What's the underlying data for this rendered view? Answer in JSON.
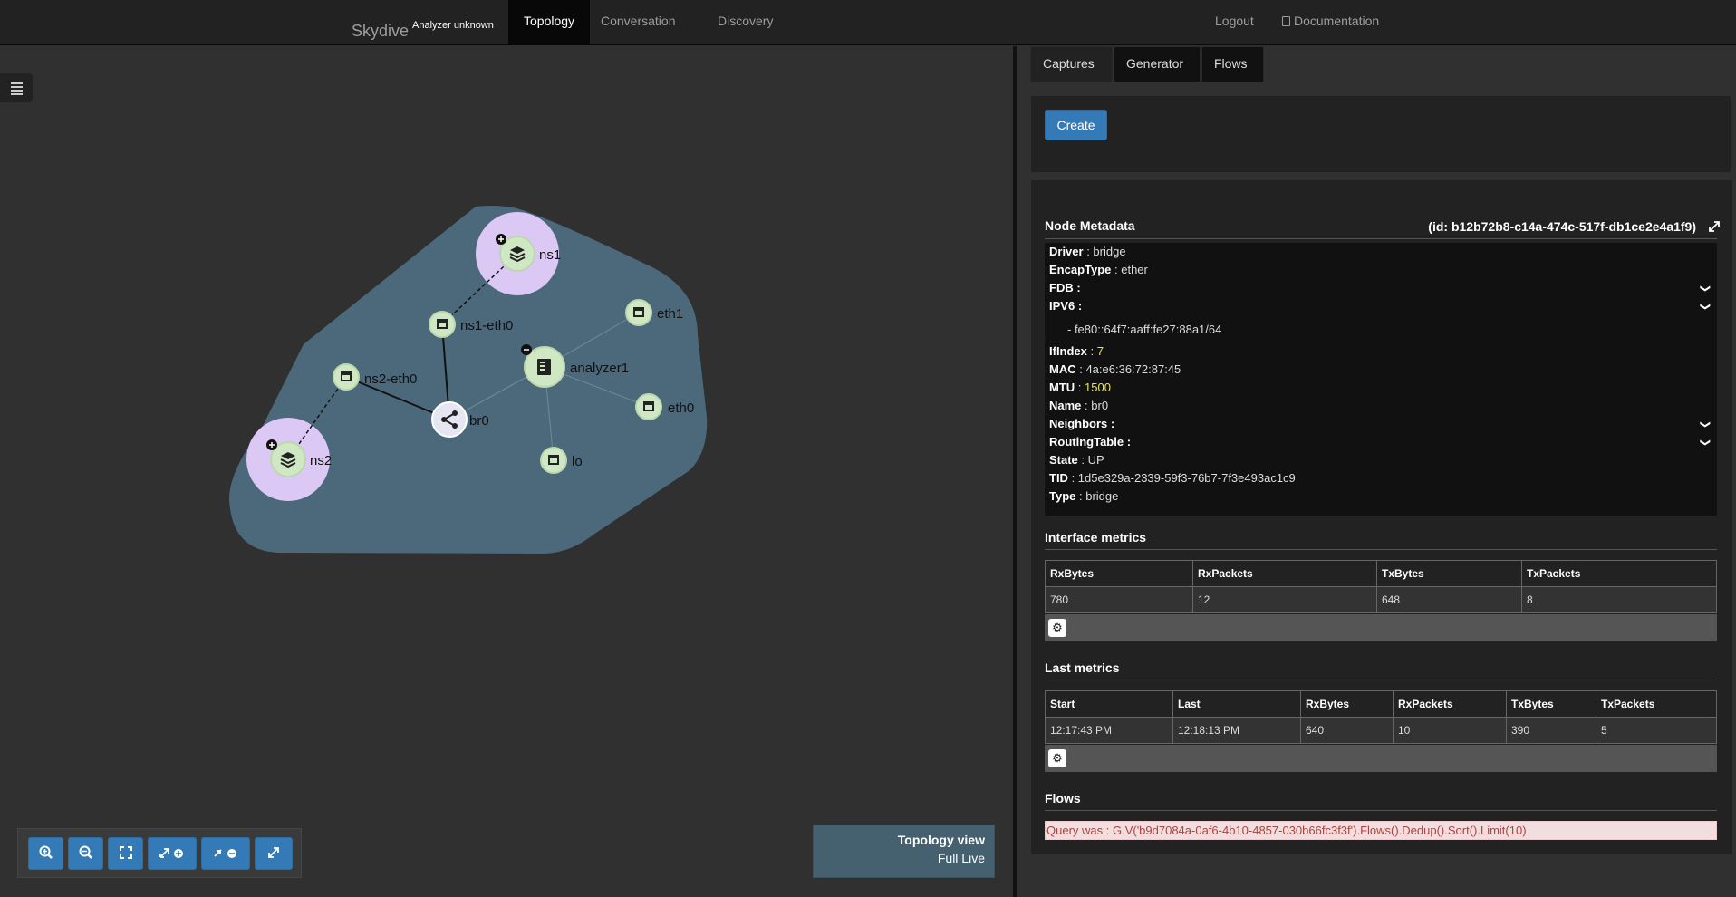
{
  "navbar": {
    "brand": "Skydive",
    "brand_sub": "Analyzer unknown",
    "tabs": [
      "Topology",
      "Conversation",
      "Discovery"
    ],
    "logout": "Logout",
    "documentation": "Documentation"
  },
  "graph": {
    "nodes": [
      {
        "id": "ns1",
        "label": "ns1",
        "icon": "namespace-stack-icon"
      },
      {
        "id": "ns1-eth0",
        "label": "ns1-eth0",
        "icon": "interface-icon"
      },
      {
        "id": "eth1",
        "label": "eth1",
        "icon": "interface-icon"
      },
      {
        "id": "analyzer1",
        "label": "analyzer1",
        "icon": "host-server-icon"
      },
      {
        "id": "ns2-eth0",
        "label": "ns2-eth0",
        "icon": "interface-icon"
      },
      {
        "id": "br0",
        "label": "br0",
        "icon": "bridge-icon"
      },
      {
        "id": "eth0",
        "label": "eth0",
        "icon": "interface-icon"
      },
      {
        "id": "ns2",
        "label": "ns2",
        "icon": "namespace-stack-icon"
      },
      {
        "id": "lo",
        "label": "lo",
        "icon": "interface-icon"
      }
    ]
  },
  "toolbar": {
    "buttons": [
      "zoom-in-icon",
      "zoom-out-icon",
      "fullscreen-icon",
      "expand-all-icon",
      "collapse-all-icon",
      "compress-icon"
    ]
  },
  "view_box": {
    "title": "Topology view",
    "mode": "Full Live"
  },
  "right_tabs": [
    "Captures",
    "Generator",
    "Flows"
  ],
  "create_label": "Create",
  "node_metadata": {
    "title": "Node Metadata",
    "id": "(id: b12b72b8-c14a-474c-517f-db1ce2e4a1f9)",
    "rows": [
      {
        "key": "Driver",
        "value": "bridge"
      },
      {
        "key": "EncapType",
        "value": "ether"
      },
      {
        "key": "FDB",
        "value": ""
      },
      {
        "key": "IPV6",
        "value": ""
      },
      {
        "key": "IfIndex",
        "value": "7"
      },
      {
        "key": "MAC",
        "value": "4a:e6:36:72:87:45"
      },
      {
        "key": "MTU",
        "value": "1500"
      },
      {
        "key": "Name",
        "value": "br0"
      },
      {
        "key": "Neighbors",
        "value": ""
      },
      {
        "key": "RoutingTable",
        "value": ""
      },
      {
        "key": "State",
        "value": "UP"
      },
      {
        "key": "TID",
        "value": "1d5e329a-2339-59f3-76b7-7f3e493ac1c9"
      },
      {
        "key": "Type",
        "value": "bridge"
      }
    ],
    "ipv6_item": "- fe80::64f7:aaff:fe27:88a1/64"
  },
  "interface_metrics": {
    "title": "Interface metrics",
    "headers": [
      "RxBytes",
      "RxPackets",
      "TxBytes",
      "TxPackets"
    ],
    "row": [
      "780",
      "12",
      "648",
      "8"
    ]
  },
  "last_metrics": {
    "title": "Last metrics",
    "headers": [
      "Start",
      "Last",
      "RxBytes",
      "RxPackets",
      "TxBytes",
      "TxPackets"
    ],
    "row": [
      "12:17:43 PM",
      "12:18:13 PM",
      "640",
      "10",
      "390",
      "5"
    ]
  },
  "flows": {
    "title": "Flows",
    "query": "Query was : G.V('b9d7084a-0af6-4b10-4857-030b66fc3f3f').Flows().Dedup().Sort().Limit(10)"
  },
  "colors": {
    "group_hull": "#4d6b7f",
    "node_fill": "#cfe8c3",
    "namespace_fill": "#d8c4f0",
    "accent": "#337ab7"
  }
}
